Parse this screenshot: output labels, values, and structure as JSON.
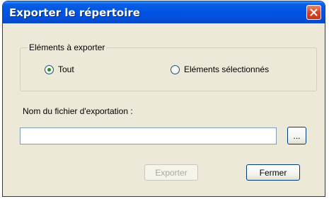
{
  "window": {
    "title": "Exporter le répertoire"
  },
  "group": {
    "legend": "Eléments à exporter",
    "options": [
      {
        "label": "Tout",
        "selected": true
      },
      {
        "label": "Eléments sélectionnés",
        "selected": false
      }
    ]
  },
  "file": {
    "label": "Nom du fichier d'exportation :",
    "value": "",
    "placeholder": "",
    "browse_label": "..."
  },
  "buttons": {
    "export_label": "Exporter",
    "export_enabled": false,
    "close_label": "Fermer"
  },
  "colors": {
    "titlebar": "#0054e3",
    "window_bg": "#ece9d8",
    "close_button": "#d2462a",
    "radio_dot": "#2a8a26"
  },
  "icons": {
    "close": "close-icon"
  }
}
